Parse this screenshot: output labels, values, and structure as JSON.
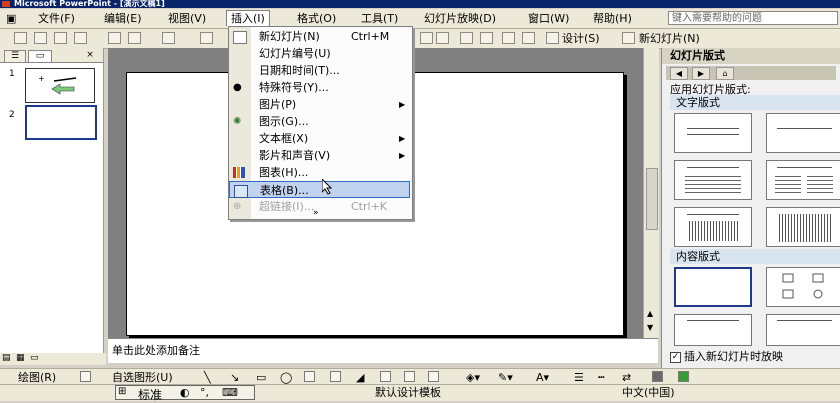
{
  "window": {
    "title": "Microsoft PowerPoint - [演示文稿1]"
  },
  "menubar": {
    "items": [
      "文件(F)",
      "编辑(E)",
      "视图(V)",
      "插入(I)",
      "格式(O)",
      "工具(T)",
      "幻灯片放映(D)",
      "窗口(W)",
      "帮助(H)"
    ],
    "help_placeholder": "键入需要帮助的问题"
  },
  "toolbar": {
    "design_label": "设计(S)",
    "new_slide_label": "新幻灯片(N)"
  },
  "insert_menu": {
    "items": [
      {
        "label": "新幻灯片(N)",
        "shortcut": "Ctrl+M"
      },
      {
        "label": "幻灯片编号(U)"
      },
      {
        "label": "日期和时间(T)..."
      },
      {
        "label": "特殊符号(Y)..."
      },
      {
        "label": "图片(P)"
      },
      {
        "label": "图示(G)..."
      },
      {
        "label": "文本框(X)"
      },
      {
        "label": "影片和声音(V)"
      },
      {
        "label": "图表(H)..."
      },
      {
        "label": "表格(B)..."
      },
      {
        "label": "超链接(I)...",
        "shortcut": "Ctrl+K"
      }
    ],
    "more": "»",
    "submenu_arrow": "▶"
  },
  "slides": {
    "numbers": [
      "1",
      "2"
    ]
  },
  "notes": {
    "placeholder": "单击此处添加备注"
  },
  "taskpane": {
    "title": "幻灯片版式",
    "apply_label": "应用幻灯片版式:",
    "text_layouts_label": "文字版式",
    "content_layouts_label": "内容版式",
    "show_on_insert_label": "插入新幻灯片时放映",
    "checked": true
  },
  "drawbar": {
    "draw_label": "绘图(R)",
    "autoshapes_label": "自选图形(U)"
  },
  "statusbar": {
    "ime_label": "标准",
    "template": "默认设计模板",
    "language": "中文(中国)"
  }
}
